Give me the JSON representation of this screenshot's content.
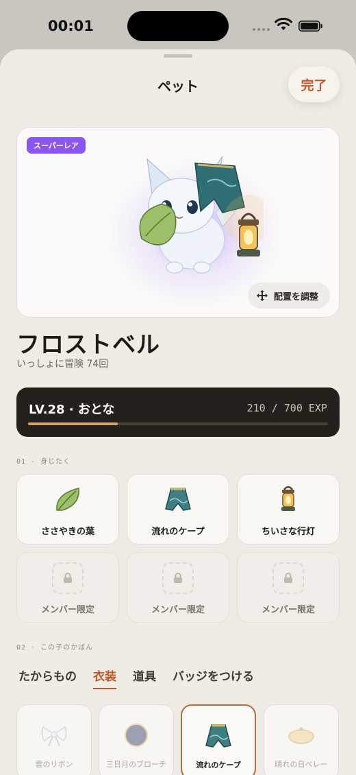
{
  "status": {
    "time": "00:01"
  },
  "header": {
    "title": "ペット",
    "done_label": "完了"
  },
  "pet": {
    "rarity": "スーパーレア",
    "adjust_label": "配置を調整",
    "name": "フロストベル",
    "subtitle": "いっしょに冒険 74回",
    "level_label": "LV.28 · おとな",
    "exp_label": "210 / 700 EXP",
    "exp_current": 210,
    "exp_max": 700
  },
  "sections": {
    "outfit": "01 · 身じたく",
    "bag": "02 · この子のかばん"
  },
  "equipped": [
    {
      "label": "ささやきの葉",
      "icon": "leaf-icon"
    },
    {
      "label": "流れのケープ",
      "icon": "cape-icon"
    },
    {
      "label": "ちいさな行灯",
      "icon": "lantern-icon"
    },
    {
      "label": "メンバー限定",
      "icon": "lock-icon"
    },
    {
      "label": "メンバー限定",
      "icon": "lock-icon"
    },
    {
      "label": "メンバー限定",
      "icon": "lock-icon"
    }
  ],
  "tabs": [
    {
      "label": "たからもの"
    },
    {
      "label": "衣装"
    },
    {
      "label": "道具"
    },
    {
      "label": "バッジをつける"
    }
  ],
  "active_tab": "衣装",
  "items": [
    {
      "label": "雲のリボン",
      "icon": "ribbon-icon"
    },
    {
      "label": "三日月のブローチ",
      "icon": "moon-brooch-icon"
    },
    {
      "label": "流れのケープ",
      "icon": "cape-icon"
    },
    {
      "label": "晴れの日ベレー",
      "icon": "beret-icon"
    }
  ],
  "colors": {
    "accent": "#c0582c",
    "rarity": "#8a55f0",
    "level_card": "#24211d",
    "exp_fill": "#d4a36a"
  }
}
